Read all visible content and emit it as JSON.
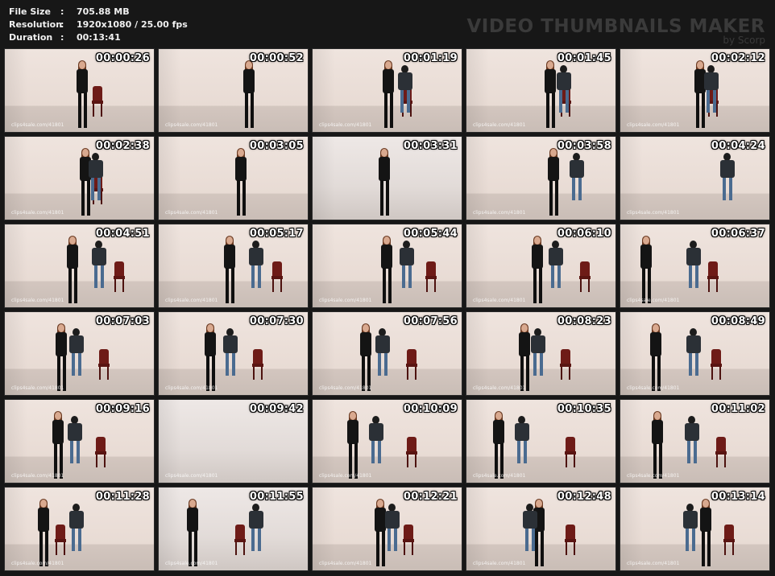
{
  "info": {
    "rows": [
      {
        "key": "File Size",
        "sep": ":",
        "value": "705.88 MB"
      },
      {
        "key": "Resolution",
        "sep": ":",
        "value": "1920x1080 / 25.00 fps"
      },
      {
        "key": "Duration",
        "sep": ":",
        "value": "00:13:41"
      }
    ]
  },
  "brand": {
    "title": "VIDEO THUMBNAILS MAKER",
    "byline": "by Scorp"
  },
  "thumbnails": [
    {
      "time": "00:00:26",
      "watermark": "clips4sale.com/41801"
    },
    {
      "time": "00:00:52",
      "watermark": "clips4sale.com/41801"
    },
    {
      "time": "00:01:19",
      "watermark": "clips4sale.com/41801"
    },
    {
      "time": "00:01:45",
      "watermark": "clips4sale.com/41801"
    },
    {
      "time": "00:02:12",
      "watermark": "clips4sale.com/41801"
    },
    {
      "time": "00:02:38",
      "watermark": "clips4sale.com/41801"
    },
    {
      "time": "00:03:05",
      "watermark": "clips4sale.com/41801"
    },
    {
      "time": "00:03:31",
      "watermark": ""
    },
    {
      "time": "00:03:58",
      "watermark": "clips4sale.com/41801"
    },
    {
      "time": "00:04:24",
      "watermark": "clips4sale.com/41801"
    },
    {
      "time": "00:04:51",
      "watermark": "clips4sale.com/41801"
    },
    {
      "time": "00:05:17",
      "watermark": "clips4sale.com/41801"
    },
    {
      "time": "00:05:44",
      "watermark": "clips4sale.com/41801"
    },
    {
      "time": "00:06:10",
      "watermark": "clips4sale.com/41801"
    },
    {
      "time": "00:06:37",
      "watermark": "clips4sale.com/41801"
    },
    {
      "time": "00:07:03",
      "watermark": "clips4sale.com/41801"
    },
    {
      "time": "00:07:30",
      "watermark": "clips4sale.com/41801"
    },
    {
      "time": "00:07:56",
      "watermark": "clips4sale.com/41801"
    },
    {
      "time": "00:08:23",
      "watermark": "clips4sale.com/41801"
    },
    {
      "time": "00:08:49",
      "watermark": "clips4sale.com/41801"
    },
    {
      "time": "00:09:16",
      "watermark": "clips4sale.com/41801"
    },
    {
      "time": "00:09:42",
      "watermark": "clips4sale.com/41801"
    },
    {
      "time": "00:10:09",
      "watermark": "clips4sale.com/41801"
    },
    {
      "time": "00:10:35",
      "watermark": "clips4sale.com/41801"
    },
    {
      "time": "00:11:02",
      "watermark": "clips4sale.com/41801"
    },
    {
      "time": "00:11:28",
      "watermark": "clips4sale.com/41801"
    },
    {
      "time": "00:11:55",
      "watermark": "clips4sale.com/41801"
    },
    {
      "time": "00:12:21",
      "watermark": "clips4sale.com/41801"
    },
    {
      "time": "00:12:48",
      "watermark": "clips4sale.com/41801"
    },
    {
      "time": "00:13:14",
      "watermark": "clips4sale.com/41801"
    }
  ]
}
